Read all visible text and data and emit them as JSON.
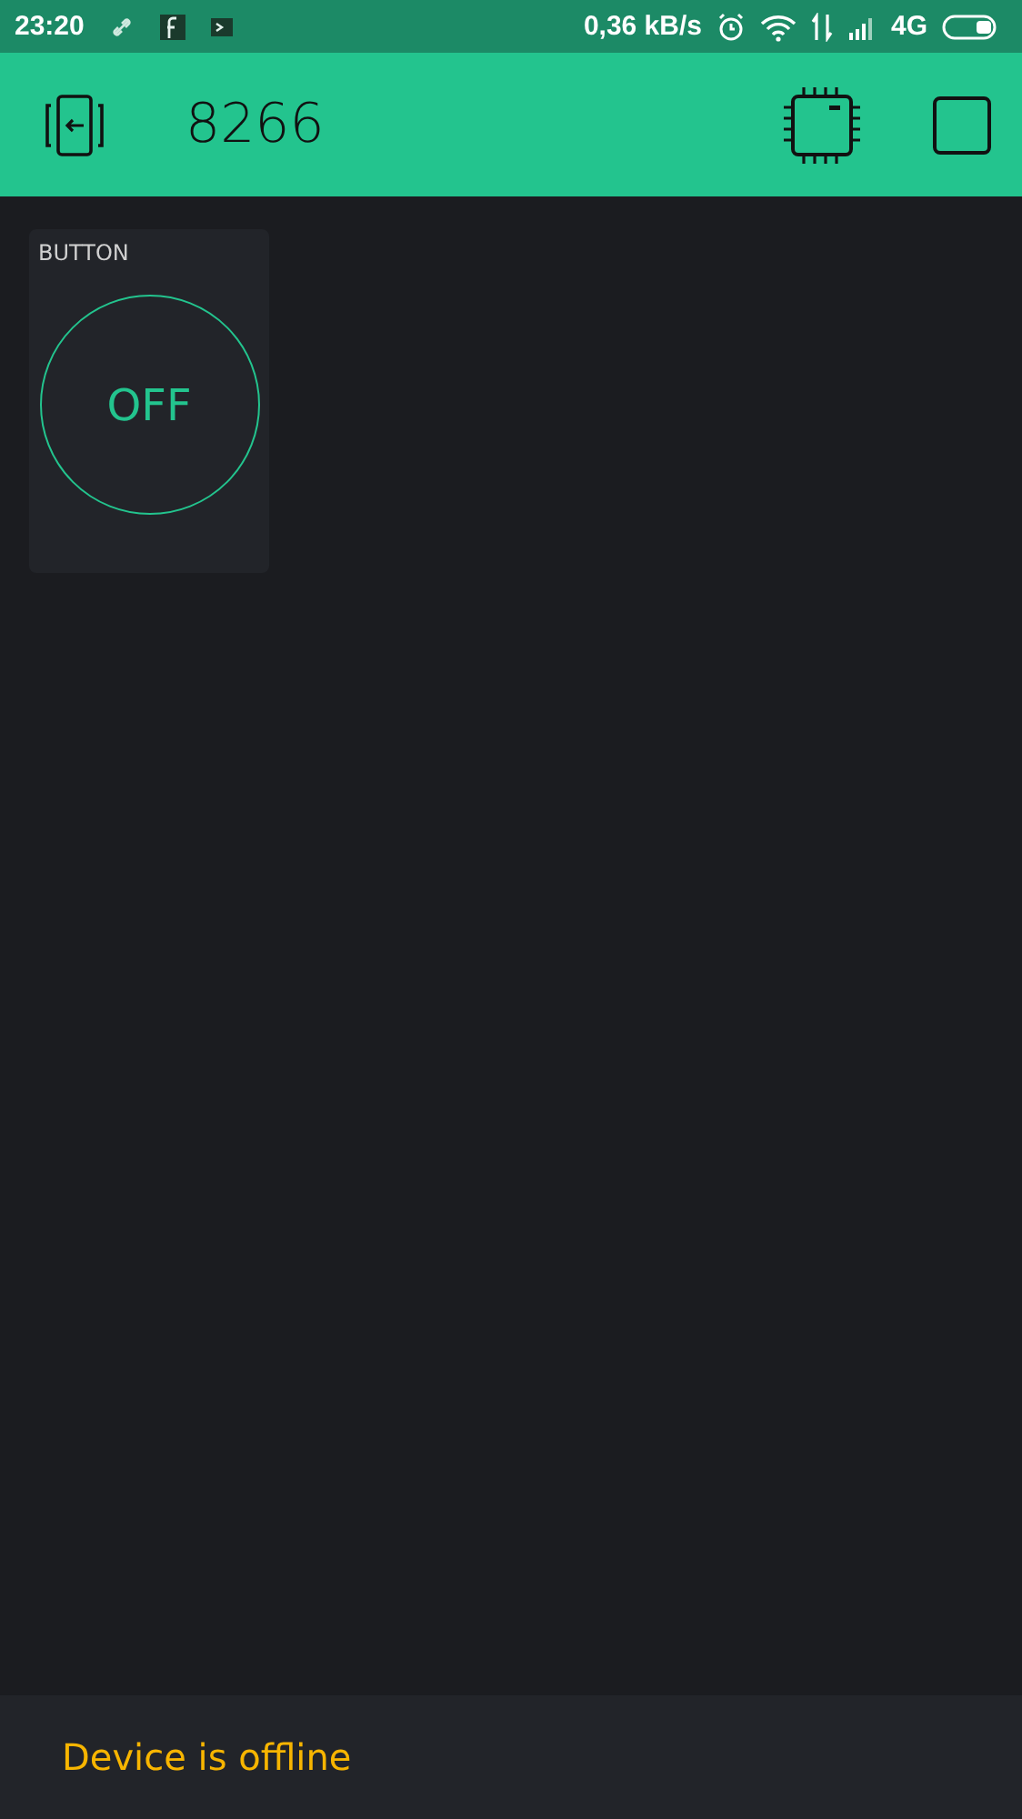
{
  "status_bar": {
    "time": "23:20",
    "net_speed": "0,36 kB/s",
    "network": "4G"
  },
  "app_bar": {
    "title": "8266"
  },
  "widgets": [
    {
      "kind": "button",
      "label": "BUTTON",
      "text": "OFF",
      "on": false
    }
  ],
  "footer": {
    "message": "Device is offline"
  }
}
